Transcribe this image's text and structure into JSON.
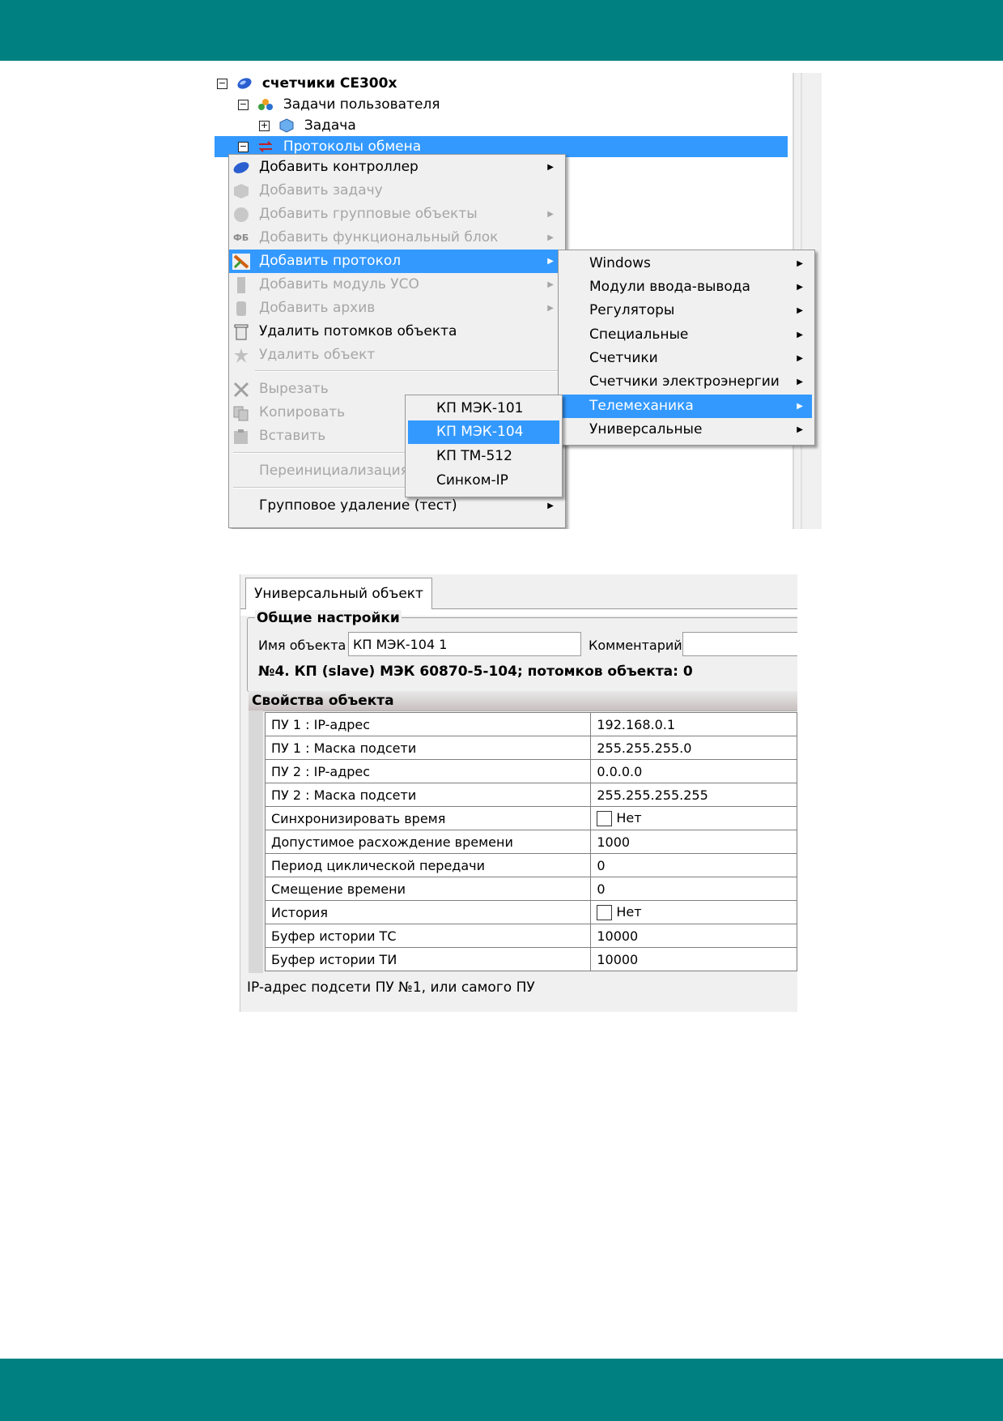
{
  "colors": {
    "teal_bar": "#008080",
    "selection": "#3399ff",
    "menu_bg": "#f0f0f0",
    "disabled_text": "#a6a6a6"
  },
  "tree": {
    "items": [
      {
        "label": "счетчики CE300x",
        "icon": "controller-icon",
        "expander": "⊟"
      },
      {
        "label": "Задачи пользователя",
        "icon": "user-tasks-icon",
        "expander": "⊟"
      },
      {
        "label": "Задача",
        "icon": "task-cube-icon",
        "expander": "⊞"
      },
      {
        "label": "Протоколы обмена",
        "icon": "exchange-arrows-icon",
        "expander": "⊟"
      }
    ]
  },
  "context_menu": {
    "items": [
      {
        "label": "Добавить контроллер",
        "icon": "controller-icon",
        "submenu": true,
        "enabled": true
      },
      {
        "label": "Добавить задачу",
        "icon": "task-icon",
        "submenu": false,
        "enabled": false
      },
      {
        "label": "Добавить групповые объекты",
        "icon": "group-objects-icon",
        "submenu": true,
        "enabled": false
      },
      {
        "label": "Добавить функциональный блок",
        "icon_text": "ФБ",
        "submenu": true,
        "enabled": false
      },
      {
        "label": "Добавить протокол",
        "icon": "protocol-icon",
        "submenu": true,
        "enabled": true,
        "highlighted": true
      },
      {
        "label": "Добавить модуль УСО",
        "icon": "io-module-icon",
        "submenu": true,
        "enabled": false
      },
      {
        "label": "Добавить архив",
        "icon": "archive-icon",
        "submenu": true,
        "enabled": false
      },
      {
        "label": "Удалить потомков объекта",
        "icon": "trash-icon",
        "submenu": false,
        "enabled": true
      },
      {
        "label": "Удалить объект",
        "icon": "delete-object-icon",
        "submenu": false,
        "enabled": false
      },
      {
        "label": "Вырезать",
        "icon": "cut-icon",
        "submenu": false,
        "enabled": false
      },
      {
        "label": "Копировать",
        "icon": "copy-icon",
        "submenu": false,
        "enabled": false
      },
      {
        "label": "Вставить",
        "icon": "paste-icon",
        "submenu": false,
        "enabled": false
      },
      {
        "label": "Переинициализация",
        "submenu": false,
        "enabled": false
      },
      {
        "label": "Групповое удаление (тест)",
        "submenu": true,
        "enabled": true
      }
    ]
  },
  "protocol_submenu": {
    "items": [
      {
        "label": "Windows"
      },
      {
        "label": "Модули ввода-вывода"
      },
      {
        "label": "Регуляторы"
      },
      {
        "label": "Специальные"
      },
      {
        "label": "Счетчики"
      },
      {
        "label": "Счетчики электроэнергии"
      },
      {
        "label": "Телемеханика",
        "highlighted": true
      },
      {
        "label": "Универсальные"
      }
    ]
  },
  "telemechanics_submenu": {
    "items": [
      {
        "label": "КП МЭК-101"
      },
      {
        "label": "КП МЭК-104",
        "highlighted": true
      },
      {
        "label": "КП ТМ-512"
      },
      {
        "label": "Синком-IP"
      }
    ]
  },
  "properties_panel": {
    "tab_label": "Универсальный объект",
    "general_title": "Общие настройки",
    "name_label": "Имя объекта",
    "name_value": "КП МЭК-104 1",
    "comment_label": "Комментарий",
    "comment_value": "",
    "object_info": "№4. КП (slave) МЭК 60870-5-104; потомков объекта: 0",
    "props_title": "Свойства объекта",
    "rows": [
      {
        "name": "ПУ 1 : IP-адрес",
        "value": "192.168.0.1"
      },
      {
        "name": "ПУ 1 : Маска подсети",
        "value": "255.255.255.0"
      },
      {
        "name": "ПУ 2 : IP-адрес",
        "value": "0.0.0.0"
      },
      {
        "name": "ПУ 2 : Маска подсети",
        "value": "255.255.255.255"
      },
      {
        "name": "Синхронизировать время",
        "value": "Нет",
        "checkbox": true
      },
      {
        "name": "Допустимое расхождение времени",
        "value": "1000"
      },
      {
        "name": "Период циклической передачи",
        "value": "0"
      },
      {
        "name": "Смещение времени",
        "value": "0"
      },
      {
        "name": "История",
        "value": "Нет",
        "checkbox": true
      },
      {
        "name": "Буфер истории ТС",
        "value": "10000"
      },
      {
        "name": "Буфер истории ТИ",
        "value": "10000"
      }
    ],
    "status_text": "IP-адрес подсети ПУ №1, или самого ПУ"
  }
}
